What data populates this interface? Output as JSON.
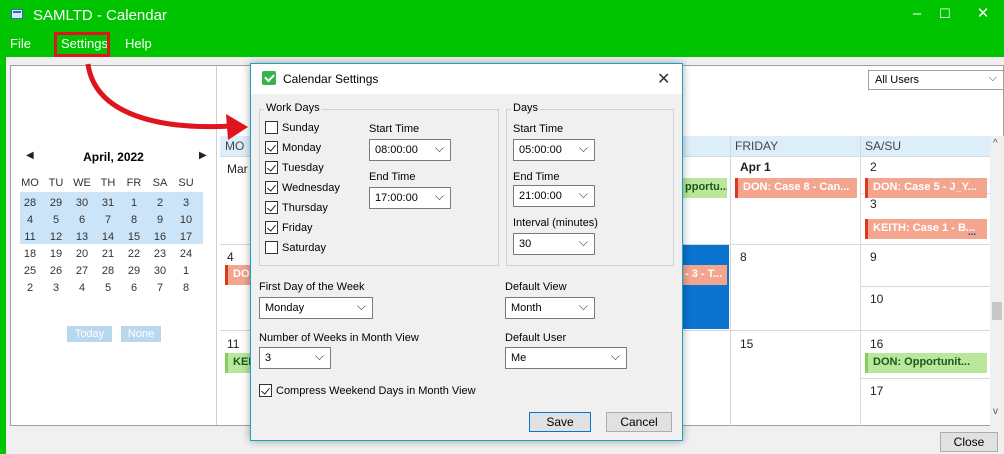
{
  "window": {
    "title": "SAMLTD - Calendar",
    "min": "–",
    "max": "☐",
    "close": "✕"
  },
  "menu": {
    "file": "File",
    "settings": "Settings",
    "help": "Help"
  },
  "mini_calendar": {
    "month": "April, 2022",
    "prev": "◀",
    "next": "▶",
    "dow": [
      "MO",
      "TU",
      "WE",
      "TH",
      "FR",
      "SA",
      "SU"
    ],
    "weeks": [
      [
        "28",
        "29",
        "30",
        "31",
        "1",
        "2",
        "3"
      ],
      [
        "4",
        "5",
        "6",
        "7",
        "8",
        "9",
        "10"
      ],
      [
        "11",
        "12",
        "13",
        "14",
        "15",
        "16",
        "17"
      ],
      [
        "18",
        "19",
        "20",
        "21",
        "22",
        "23",
        "24"
      ],
      [
        "25",
        "26",
        "27",
        "28",
        "29",
        "30",
        "1"
      ],
      [
        "2",
        "3",
        "4",
        "5",
        "6",
        "7",
        "8"
      ]
    ],
    "today_btn": "Today",
    "none_btn": "None"
  },
  "calendar": {
    "users_filter": "All Users",
    "columns": {
      "mon": "MO",
      "fri": "FRIDAY",
      "sasu": "SA/SU"
    },
    "cells": {
      "mon_w1": "Mar",
      "fri_w1": "Apr 1",
      "sat_w1": "2",
      "sun_w1": "3",
      "mon_w2": "4",
      "fri_w2": "8",
      "sat_w2": "9",
      "sun_w2": "10",
      "mon_w3": "11",
      "fri_w3": "15",
      "sat_w3": "16",
      "sun_w3": "17"
    },
    "events": {
      "thu_w1": "pportu...",
      "fri_w1": "DON: Case 8 - Can...",
      "sat_w1": "DON: Case 5 - J_Y...",
      "sun_w1": "KEITH: Case 1 - B...",
      "mon_w2": "DO",
      "thu_w2": "- 3 - T...",
      "mon_w3": "KEI",
      "sat_w3": "DON: Opportunit..."
    },
    "more": "...",
    "close_btn": "Close"
  },
  "dialog": {
    "title": "Calendar Settings",
    "close": "✕",
    "work_days": {
      "label": "Work Days",
      "start_time_label": "Start Time",
      "start_time": "08:00:00",
      "end_time_label": "End Time",
      "end_time": "17:00:00",
      "days": [
        {
          "name": "Sunday",
          "checked": false
        },
        {
          "name": "Monday",
          "checked": true
        },
        {
          "name": "Tuesday",
          "checked": true
        },
        {
          "name": "Wednesday",
          "checked": true
        },
        {
          "name": "Thursday",
          "checked": true
        },
        {
          "name": "Friday",
          "checked": true
        },
        {
          "name": "Saturday",
          "checked": false
        }
      ]
    },
    "days": {
      "label": "Days",
      "start_time_label": "Start Time",
      "start_time": "05:00:00",
      "end_time_label": "End Time",
      "end_time": "21:00:00",
      "interval_label": "Interval (minutes)",
      "interval": "30"
    },
    "first_day_label": "First Day of the Week",
    "first_day": "Monday",
    "default_view_label": "Default View",
    "default_view": "Month",
    "weeks_label": "Number of Weeks in Month View",
    "weeks": "3",
    "default_user_label": "Default User",
    "default_user": "Me",
    "compress_label": "Compress Weekend Days in Month View",
    "compress_checked": true,
    "save": "Save",
    "cancel": "Cancel"
  },
  "colors": {
    "title_green": "#00c400",
    "accent_red": "#e0141e",
    "event_red": "#f4a58e",
    "event_green": "#b9e79c"
  }
}
